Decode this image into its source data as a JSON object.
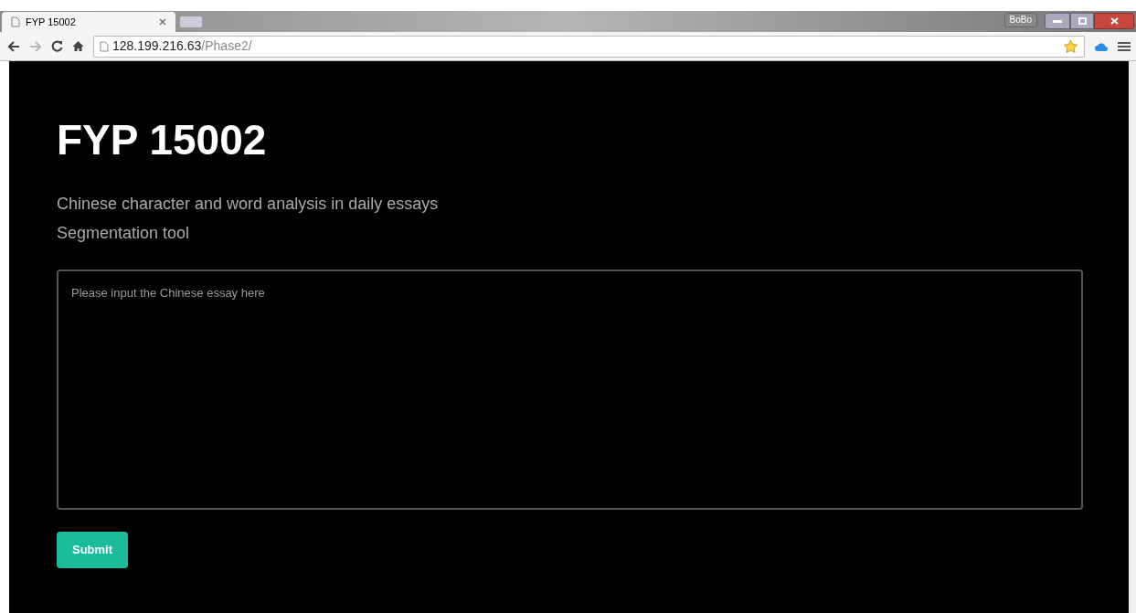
{
  "browser": {
    "tabs": [
      {
        "title": "FYP 15002",
        "selected": true
      }
    ],
    "profile": "BoBo",
    "address": {
      "host": "128.199.216.63",
      "path": "/Phase2/"
    }
  },
  "page": {
    "title": "FYP 15002",
    "subtitle_lines": [
      "Chinese character and word analysis in daily essays",
      "Segmentation tool"
    ],
    "essay_field": {
      "placeholder": "Please input the Chinese essay here"
    },
    "submit_button": "Submit"
  }
}
